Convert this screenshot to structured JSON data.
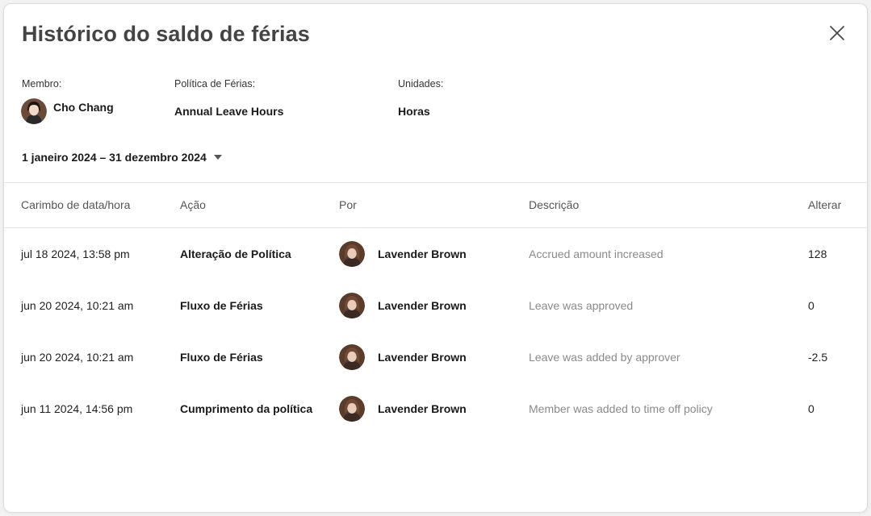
{
  "modal": {
    "title": "Histórico do saldo de férias"
  },
  "icons": {
    "close": "close-icon",
    "caret": "caret-down-icon",
    "avatar": "avatar"
  },
  "meta": {
    "member_label": "Membro:",
    "member_name": "Cho Chang",
    "policy_label": "Política de Férias:",
    "policy_value": "Annual Leave Hours",
    "units_label": "Unidades:",
    "units_value": "Horas"
  },
  "filter": {
    "date_range": "1 janeiro 2024 – 31 dezembro 2024"
  },
  "table": {
    "headers": {
      "timestamp": "Carimbo de data/hora",
      "action": "Ação",
      "by": "Por",
      "description": "Descrição",
      "change": "Alterar"
    },
    "rows": [
      {
        "timestamp": "jul 18 2024, 13:58 pm",
        "action": "Alteração de Política",
        "by": "Lavender Brown",
        "description": "Accrued amount increased",
        "change": "128"
      },
      {
        "timestamp": "jun 20 2024, 10:21 am",
        "action": "Fluxo de Férias",
        "by": "Lavender Brown",
        "description": "Leave was approved",
        "change": "0"
      },
      {
        "timestamp": "jun 20 2024, 10:21 am",
        "action": "Fluxo de Férias",
        "by": "Lavender Brown",
        "description": "Leave was added by approver",
        "change": "-2.5"
      },
      {
        "timestamp": "jun 11 2024, 14:56 pm",
        "action": "Cumprimento da política",
        "by": "Lavender Brown",
        "description": "Member was added to time off policy",
        "change": "0"
      }
    ]
  },
  "colors": {
    "title": "#444444",
    "description_text": "#8a8a8a",
    "divider": "#e6e6e6"
  }
}
